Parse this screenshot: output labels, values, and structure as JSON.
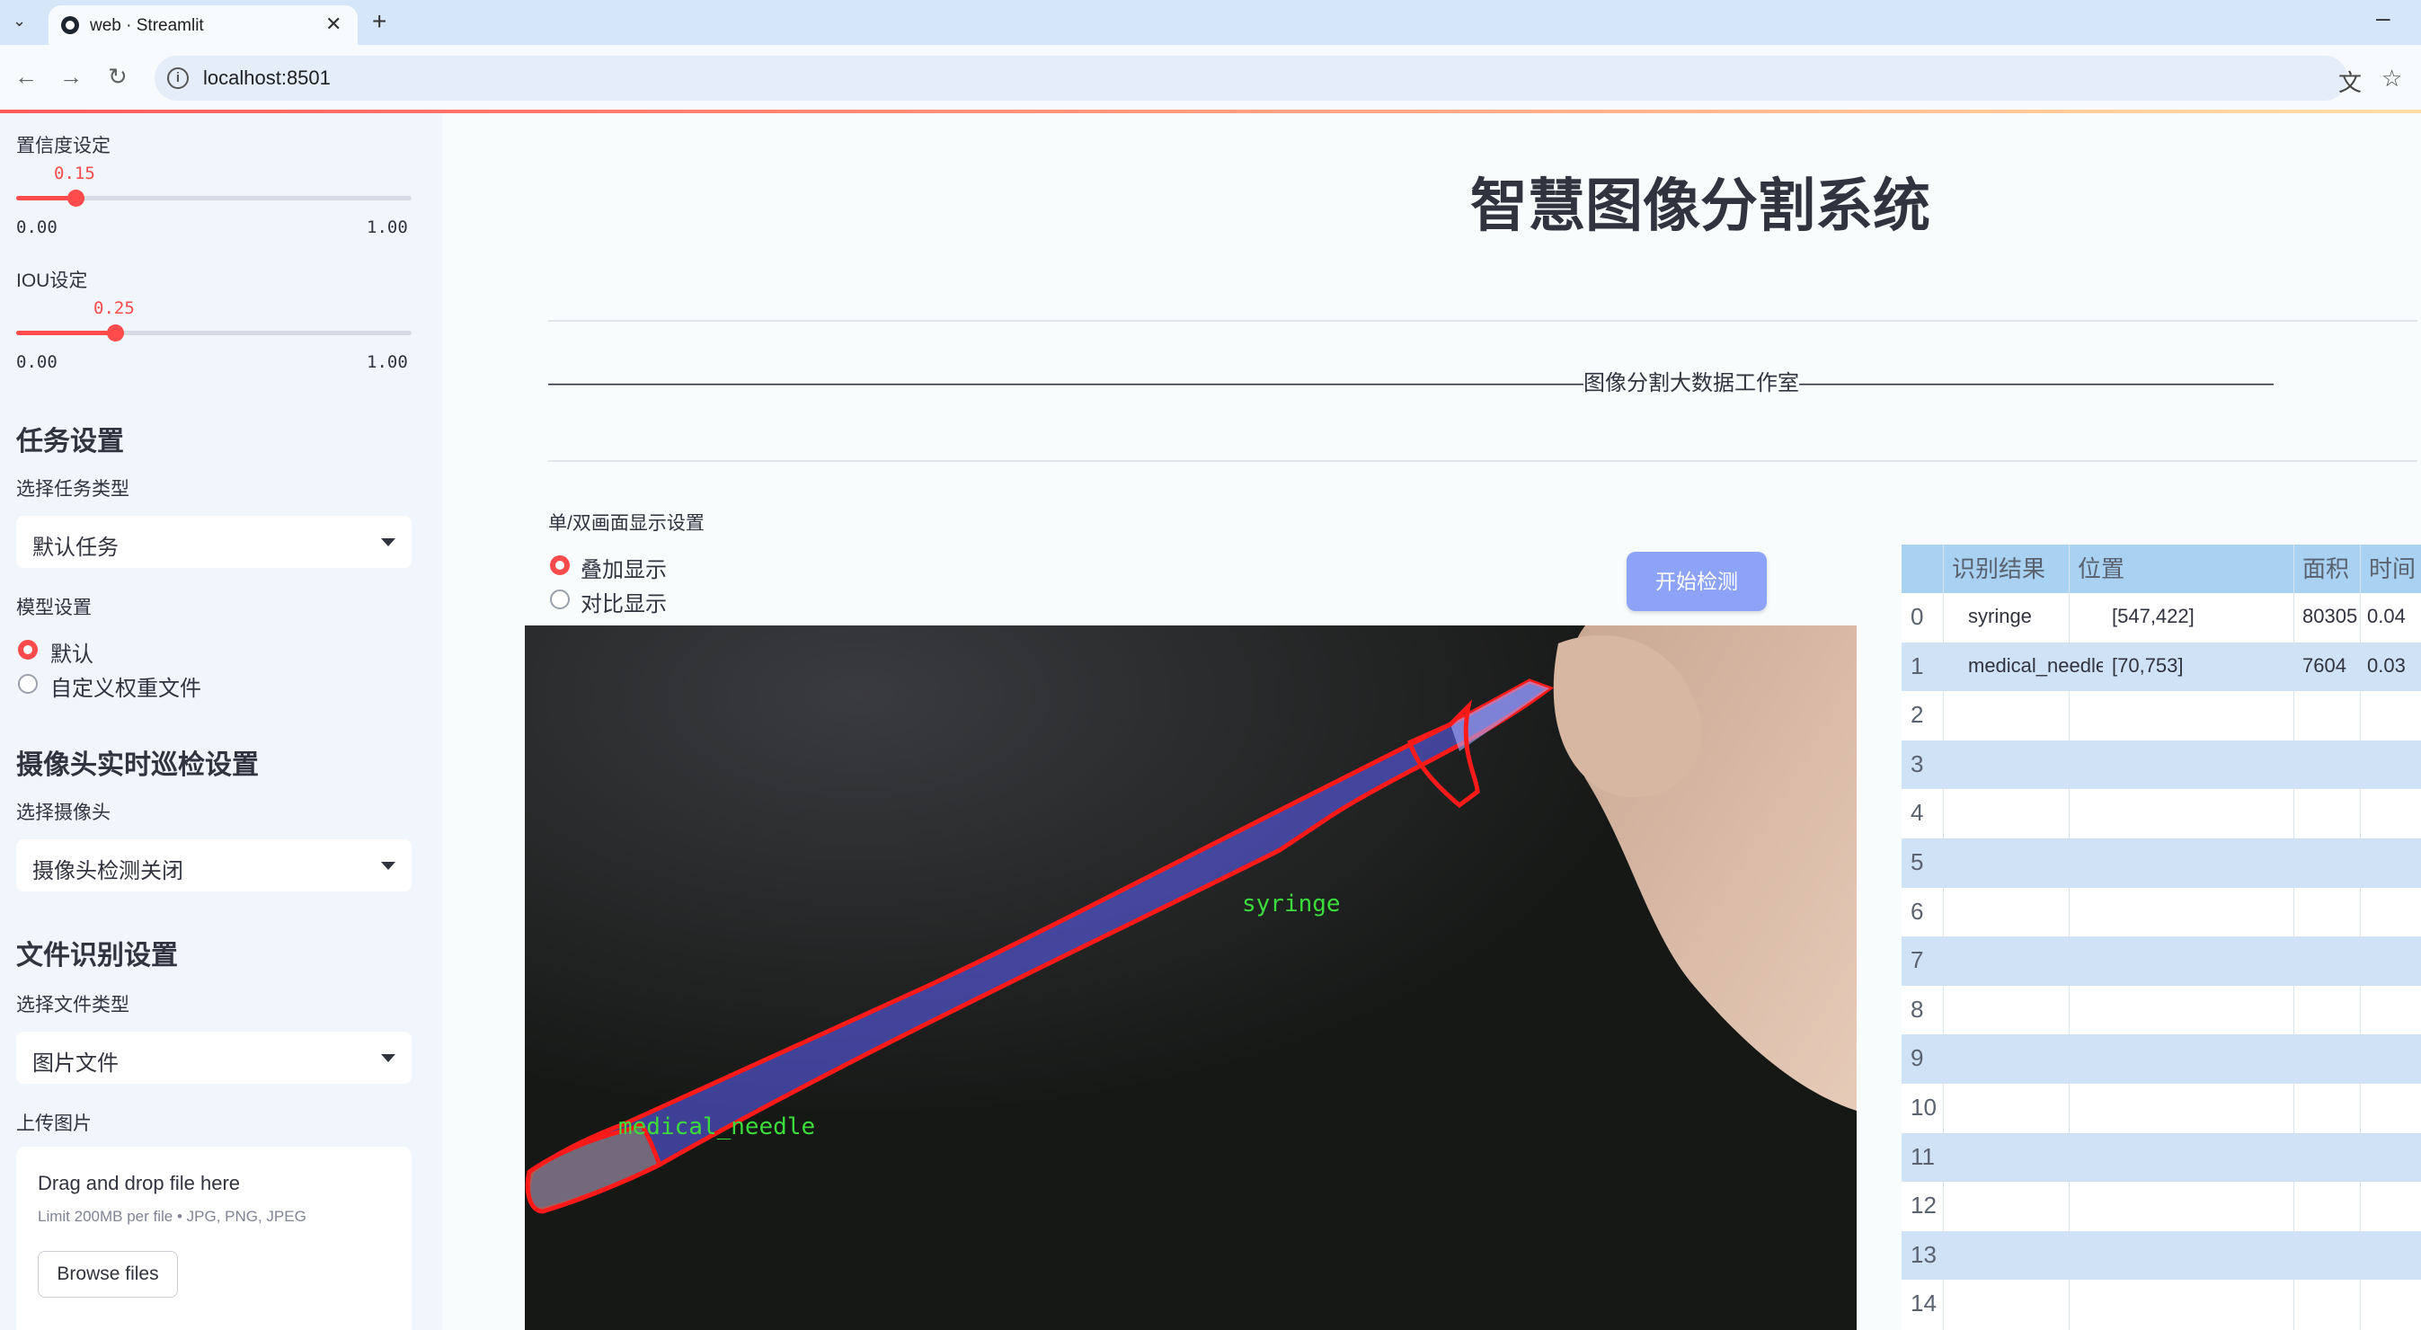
{
  "browser": {
    "tab_title": "web · Streamlit",
    "url": "localhost:8501",
    "icons": [
      "tab-list-icon",
      "streamlit-favicon",
      "close-icon",
      "new-tab-icon",
      "minimize-icon",
      "back-icon",
      "forward-icon",
      "reload-icon",
      "site-info-icon",
      "translate-icon",
      "bookmark-star-icon"
    ]
  },
  "sidebar": {
    "confidence": {
      "label": "置信度设定",
      "value": "0.15",
      "value_num": 0.15,
      "min": "0.00",
      "max": "1.00"
    },
    "iou": {
      "label": "IOU设定",
      "value": "0.25",
      "value_num": 0.25,
      "min": "0.00",
      "max": "1.00"
    },
    "task_header": "任务设置",
    "task_type_label": "选择任务类型",
    "task_type_value": "默认任务",
    "model_label": "模型设置",
    "model_options": [
      "默认",
      "自定义权重文件"
    ],
    "camera_header": "摄像头实时巡检设置",
    "camera_label": "选择摄像头",
    "camera_value": "摄像头检测关闭",
    "file_header": "文件识别设置",
    "file_type_label": "选择文件类型",
    "file_type_value": "图片文件",
    "upload_label": "上传图片",
    "upload_title": "Drag and drop file here",
    "upload_sub": "Limit 200MB per file • JPG, PNG, JPEG",
    "browse_button": "Browse files"
  },
  "main": {
    "title": "智慧图像分割系统",
    "dash_text": "————————————————————————————————————————————————图像分割大数据工作室———————————————————————————————————————————————————",
    "display_label": "单/双画面显示设置",
    "display_options": [
      "叠加显示",
      "对比显示"
    ],
    "start_button": "开始检测",
    "detections": [
      {
        "label": "syringe",
        "color": "#3bdc3b"
      },
      {
        "label": "medical_needle",
        "color": "#3bdc3b"
      }
    ],
    "mask_color": "#5f63ff",
    "outline_color": "#ff1a1a"
  },
  "table": {
    "headers": [
      "识别结果",
      "位置",
      "面积",
      "时间"
    ],
    "rows": [
      {
        "idx": "0",
        "result": "syringe",
        "pos": "[547,422]",
        "area": "80305",
        "time": "0.04"
      },
      {
        "idx": "1",
        "result": "medical_needle",
        "pos": "[70,753]",
        "area": "7604",
        "time": "0.03"
      },
      {
        "idx": "2",
        "result": "",
        "pos": "",
        "area": "",
        "time": ""
      },
      {
        "idx": "3",
        "result": "",
        "pos": "",
        "area": "",
        "time": ""
      },
      {
        "idx": "4",
        "result": "",
        "pos": "",
        "area": "",
        "time": ""
      },
      {
        "idx": "5",
        "result": "",
        "pos": "",
        "area": "",
        "time": ""
      },
      {
        "idx": "6",
        "result": "",
        "pos": "",
        "area": "",
        "time": ""
      },
      {
        "idx": "7",
        "result": "",
        "pos": "",
        "area": "",
        "time": ""
      },
      {
        "idx": "8",
        "result": "",
        "pos": "",
        "area": "",
        "time": ""
      },
      {
        "idx": "9",
        "result": "",
        "pos": "",
        "area": "",
        "time": ""
      },
      {
        "idx": "10",
        "result": "",
        "pos": "",
        "area": "",
        "time": ""
      },
      {
        "idx": "11",
        "result": "",
        "pos": "",
        "area": "",
        "time": ""
      },
      {
        "idx": "12",
        "result": "",
        "pos": "",
        "area": "",
        "time": ""
      },
      {
        "idx": "13",
        "result": "",
        "pos": "",
        "area": "",
        "time": ""
      },
      {
        "idx": "14",
        "result": "",
        "pos": "",
        "area": "",
        "time": ""
      }
    ]
  }
}
